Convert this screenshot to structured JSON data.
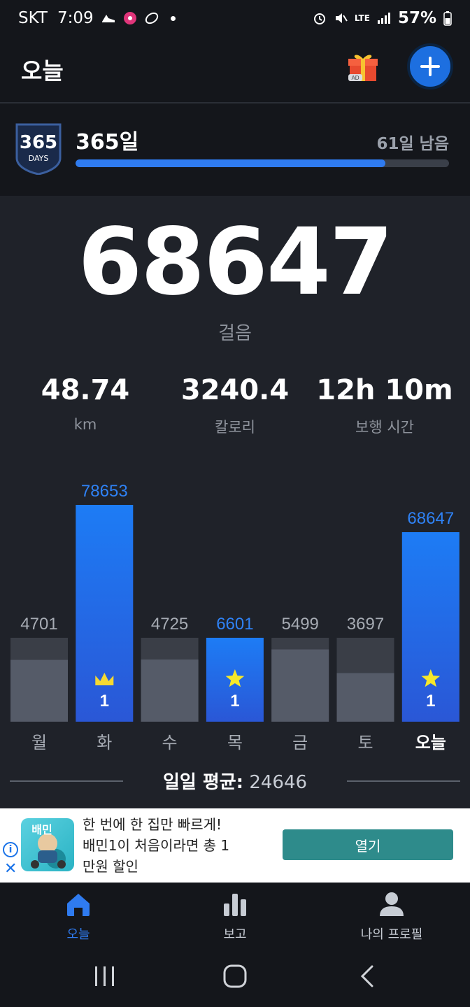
{
  "status_bar": {
    "carrier": "SKT",
    "time": "7:09",
    "battery": "57%",
    "network": "LTE"
  },
  "header": {
    "title": "오늘",
    "gift_icon": "gift-ad-icon",
    "add_icon": "plus-icon",
    "accent": "#1d6fe0"
  },
  "challenge": {
    "badge_number": "365",
    "badge_word": "DAYS",
    "title": "365일",
    "remaining": "61일 남음",
    "progress": 0.83
  },
  "today": {
    "steps": "68647",
    "steps_label": "걸음"
  },
  "stats": [
    {
      "value": "48.74",
      "label": "km"
    },
    {
      "value": "3240.4",
      "label": "칼로리"
    },
    {
      "value": "12h 10m",
      "label": "보행 시간"
    }
  ],
  "chart_data": {
    "type": "bar",
    "categories": [
      "월",
      "화",
      "수",
      "목",
      "금",
      "토",
      "오늘"
    ],
    "values": [
      4701,
      78653,
      4725,
      6601,
      5499,
      3697,
      68647
    ],
    "goal": 6000,
    "highlighted": [
      false,
      true,
      false,
      true,
      false,
      false,
      true
    ],
    "markers": [
      {
        "index": 1,
        "icon": "crown-icon",
        "count": "1"
      },
      {
        "index": 3,
        "icon": "star-icon",
        "count": "1"
      },
      {
        "index": 6,
        "icon": "star-icon",
        "count": "1"
      }
    ],
    "colors": {
      "highlight": "#1f72ef",
      "normal": "#555b68",
      "goal_band": "#3a3e47",
      "label_highlight": "#2f82f5",
      "label_normal": "#a6abb3"
    }
  },
  "average": {
    "label": "일일 평균",
    "value": "24646"
  },
  "ad": {
    "line1": "한 번에 한 집만 빠르게!",
    "line2": "배민1이 처음이라면 총 1",
    "line3": "만원 할인",
    "button": "열기",
    "image_text": "배민"
  },
  "nav": [
    {
      "label": "오늘",
      "icon": "home-icon",
      "active": true
    },
    {
      "label": "보고",
      "icon": "bar-chart-icon",
      "active": false
    },
    {
      "label": "나의 프로필",
      "icon": "profile-icon",
      "active": false
    }
  ]
}
